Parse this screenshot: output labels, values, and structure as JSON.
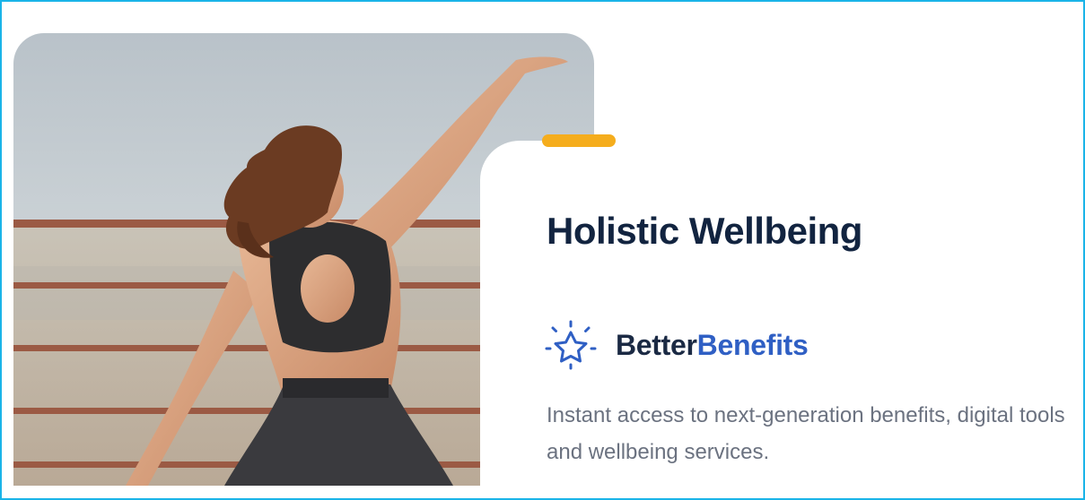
{
  "card": {
    "title": "Holistic Wellbeing",
    "brand": {
      "icon": "sparkle-star-icon",
      "name_part1": "Better",
      "name_part2": "Benefits"
    },
    "description": "Instant access to next-generation benefits, digital tools and wellbeing services."
  },
  "photo": {
    "subject": "woman-yoga-pose-photo"
  },
  "colors": {
    "frame_border": "#1ab4e8",
    "accent": "#f5ad1d",
    "title": "#122440",
    "brand_dark": "#1b2a44",
    "brand_blue": "#2f5fc4",
    "description": "#6b7280"
  }
}
